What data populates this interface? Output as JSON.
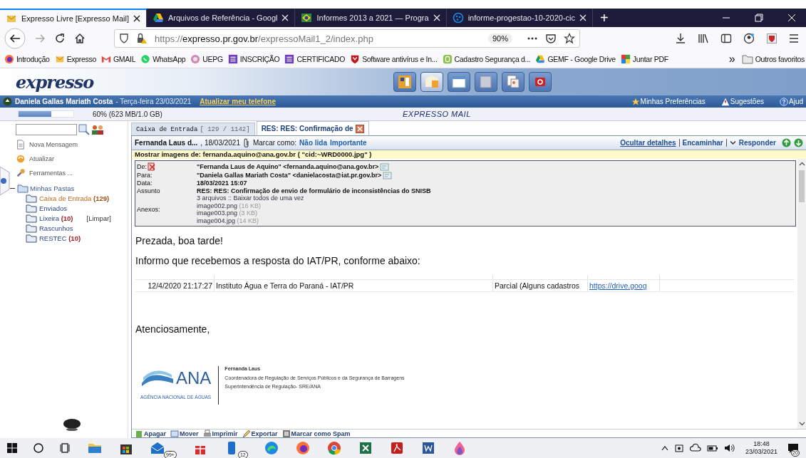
{
  "browser": {
    "tabs": [
      {
        "title": "Expresso Livre [Expresso Mail]",
        "selected": true
      },
      {
        "title": "Arquivos de Referência - Googl",
        "selected": false
      },
      {
        "title": "Informes 2013 a 2021 — Progra",
        "selected": false
      },
      {
        "title": "informe-progestao-10-2020-cic",
        "selected": false
      }
    ],
    "new_tab": "+",
    "url": {
      "scheme": "https://",
      "host": "expresso.pr.gov.br",
      "path": "/expressoMail1_2/index.php"
    },
    "zoom": "90%",
    "bookmarks": [
      "Introdução",
      "Expresso",
      "GMAIL",
      "WhatsApp",
      "UEPG",
      "INSCRIÇÃO",
      "CERTIFICADO",
      "Software antivírus e In...",
      "Cadastro Segurança d...",
      "GEMF - Google Drive",
      "Juntar PDF"
    ],
    "more": "»",
    "other_bookmarks": "Outros favoritos"
  },
  "app": {
    "logo": "expresso",
    "user": "Daniela Gallas Mariath Costa",
    "date": "- Terça-feira 23/03/2021",
    "update_phone": "Atualizar meu telefone",
    "top_links": [
      "Minhas Preferências",
      "Sugestões",
      "Ajud"
    ],
    "quota": {
      "level": 0.6,
      "text": "60% (623 MB/1.0 GB)"
    },
    "module_title": "EXPRESSO MAIL"
  },
  "sidebar": {
    "actions": [
      "Nova Mensagem",
      "Atualizar",
      "Ferramentas ..."
    ],
    "folders": {
      "label": "Minhas Pastas",
      "expanded": true,
      "children": [
        {
          "label": "Caixa de Entrada",
          "count": "(129)",
          "selected": true
        },
        {
          "label": "Enviados",
          "selected": false
        },
        {
          "label": "Lixeira",
          "count": "(10)",
          "action": "[Limpar]",
          "selected": false
        },
        {
          "label": "Rascunhos",
          "selected": false
        },
        {
          "label": "RESTEC",
          "count": "(10)",
          "selected": false
        }
      ]
    }
  },
  "mail_tabs": [
    {
      "label": "Caixa de Entrada",
      "counts": "[ 129 / 1142]",
      "selected": false
    },
    {
      "label": "RES: RES: Confirmação de",
      "selected": true,
      "closable": true
    }
  ],
  "message": {
    "sender": "Fernanda Laus d...",
    "date": ", 18/03/2021",
    "mark_as": "Marcar como:",
    "mark_links": [
      "Não lida",
      "Importante"
    ],
    "actions": [
      "Ocultar detalhes",
      "Encaminhar",
      "Responder"
    ],
    "images_notice": "Mostrar imagens de: fernanda.aquino@ana.gov.br ( \"cid:~WRD0000.jpg\" )",
    "fields": [
      {
        "label": "De:",
        "value": "\"Fernanda Laus de Aquino\" <fernanda.aquino@ana.gov.br>",
        "kind": "contact"
      },
      {
        "label": "Para:",
        "value": "\"Daniela Gallas Mariath Costa\" <danielacosta@iat.pr.gov.br>",
        "kind": "contact"
      },
      {
        "label": "Data:",
        "value": "18/03/2021 15:07",
        "kind": "text"
      },
      {
        "label": "Assunto",
        "value": "RES: RES: Confirmação de envio de formulário de inconsistências do SNISB",
        "kind": "text"
      }
    ],
    "attachments": {
      "label": "Anexos:",
      "summary": "3 arquivos :: Baixar todos de uma vez",
      "files": [
        {
          "name": "image002.png",
          "size": "(16 KB)"
        },
        {
          "name": "image003.png",
          "size": "(3 KB)"
        },
        {
          "name": "image004.jpg",
          "size": "(14 KB)"
        }
      ]
    },
    "body": {
      "greeting": "Prezada, boa tarde!",
      "intro": "Informo que recebemos a resposta do IAT/PR, conforme abaixo:",
      "table_row": [
        "12/4/2020 21:17:27",
        "Instituto Água e Terra do Paraná - IAT/PR",
        "Parcial (Alguns cadastros",
        "https://drive.goog"
      ],
      "closing": "Atenciosamente,"
    },
    "signature": {
      "logo_text": "ANA",
      "logo_caption": "AGÊNCIA NACIONAL DE ÁGUAS",
      "name": "Fernanda Laus",
      "role": "Coordenadora de Regulação de Serviços Públicos e da Segurança de Barragens",
      "unit": "Superintendência de Regulação- SRE/ANA"
    },
    "toolbar": [
      "Apagar",
      "Mover",
      "Imprimir",
      "Exportar",
      "Marcar como Spam"
    ]
  },
  "taskbar": {
    "apps": [
      {
        "kind": "folder"
      },
      {
        "kind": "store"
      },
      {
        "kind": "mail",
        "badge": "99+"
      },
      {
        "kind": "gift"
      },
      {
        "kind": "phone",
        "badge": "12"
      },
      {
        "kind": "edge"
      },
      {
        "kind": "firefox"
      },
      {
        "kind": "chrome"
      },
      {
        "kind": "excel"
      },
      {
        "kind": "acrobat"
      },
      {
        "kind": "word"
      },
      {
        "kind": "paint"
      }
    ],
    "time": "18:48",
    "date": "23/03/2021",
    "notifications": "20"
  }
}
